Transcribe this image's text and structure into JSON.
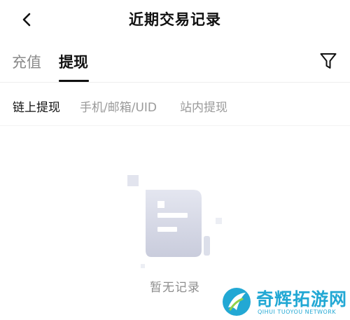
{
  "header": {
    "title": "近期交易记录",
    "back_icon": "chevron-left-icon"
  },
  "tabs": {
    "items": [
      {
        "label": "充值",
        "active": false
      },
      {
        "label": "提现",
        "active": true
      }
    ],
    "filter_icon": "filter-funnel-icon"
  },
  "subtabs": {
    "items": [
      {
        "label": "链上提现",
        "active": true
      },
      {
        "label": "手机/邮箱/UID",
        "active": false
      },
      {
        "label": "站内提现",
        "active": false
      }
    ]
  },
  "empty_state": {
    "text": "暂无记录",
    "icon": "document-empty-icon"
  },
  "watermark": {
    "name": "奇辉拓游网",
    "subtitle": "QIHUI TUOYOU NETWORK",
    "brand_color": "#22a8d4"
  },
  "colors": {
    "active_text": "#111111",
    "inactive_text": "#8a8a8a",
    "illustration": "#d9dbe8"
  }
}
